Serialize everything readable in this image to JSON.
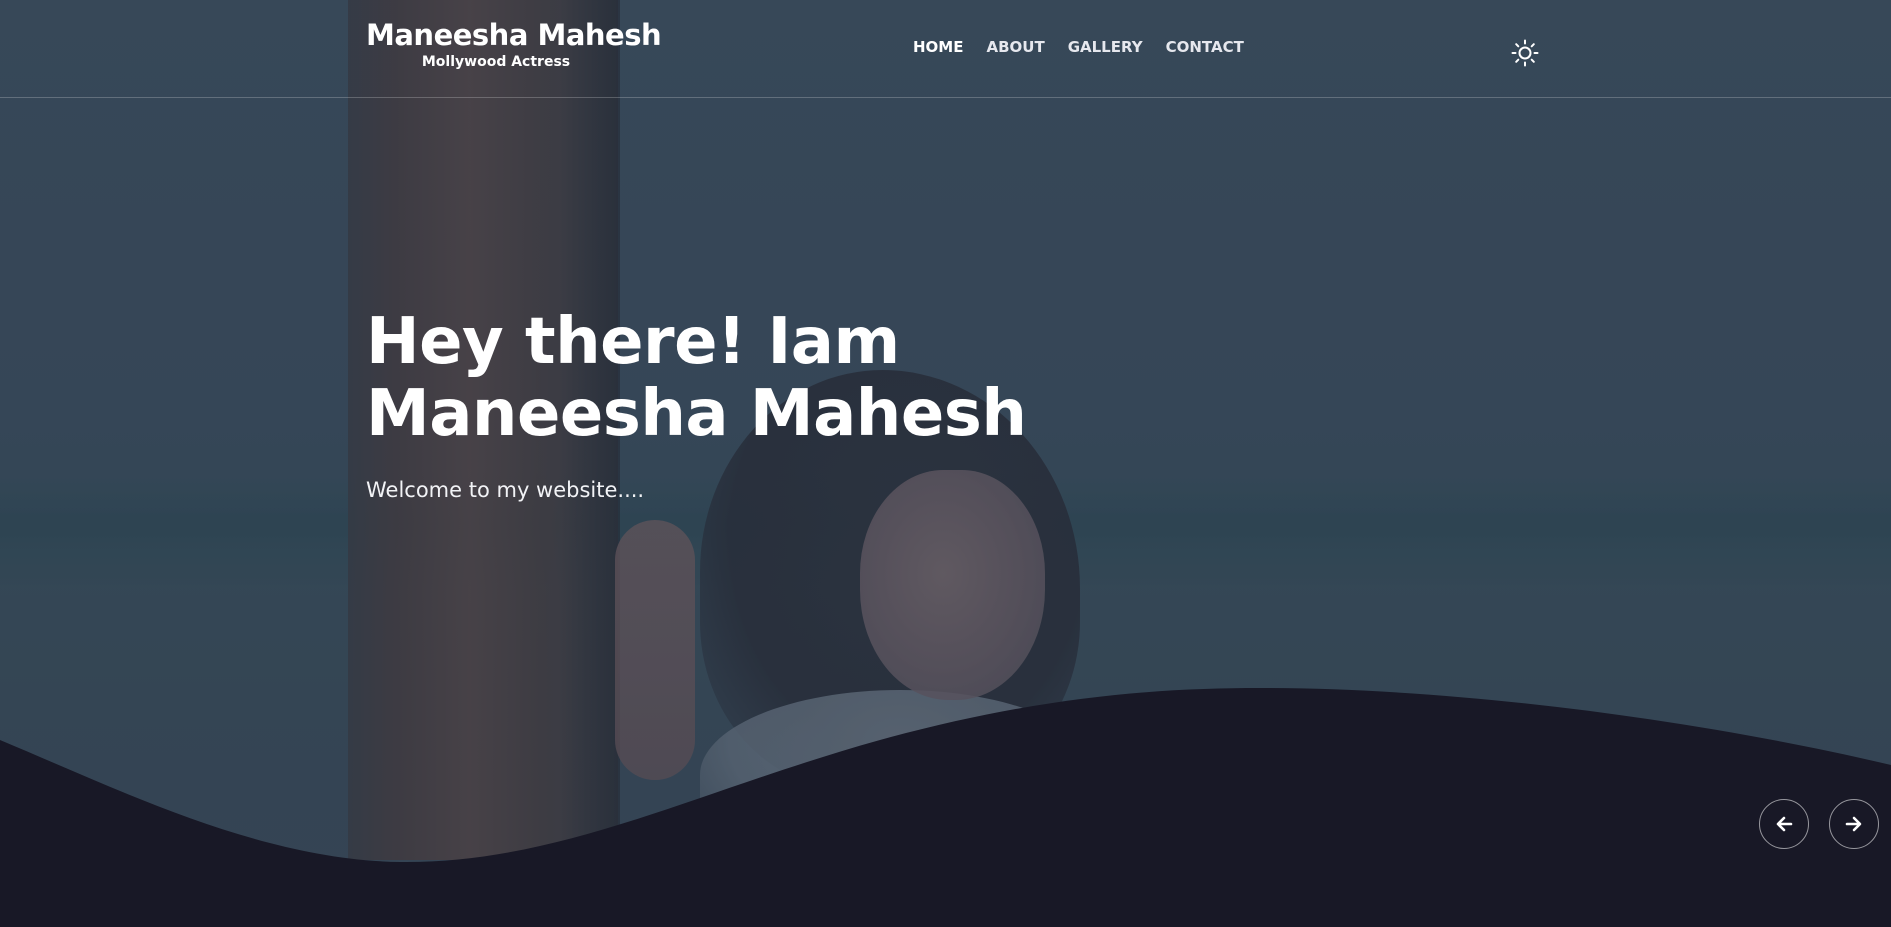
{
  "header": {
    "brand_title": "Maneesha Mahesh",
    "brand_subtitle": "Mollywood Actress",
    "nav": [
      {
        "label": "HOME",
        "active": true
      },
      {
        "label": "ABOUT",
        "active": false
      },
      {
        "label": "GALLERY",
        "active": false
      },
      {
        "label": "CONTACT",
        "active": false
      }
    ],
    "theme_toggle_icon": "sun-icon"
  },
  "hero": {
    "title": "Hey there! Iam Maneesha Mahesh",
    "subtitle": "Welcome to my website....",
    "prev_icon": "arrow-left-icon",
    "next_icon": "arrow-right-icon"
  },
  "colors": {
    "background_dark": "#181826",
    "hero_overlay": "#3b4d5e",
    "text": "#ffffff"
  }
}
